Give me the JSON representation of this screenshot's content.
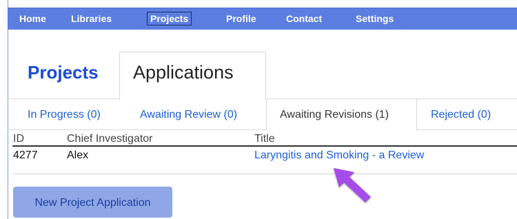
{
  "nav": {
    "items": [
      "Home",
      "Libraries",
      "Projects",
      "Profile",
      "Contact",
      "Settings"
    ],
    "active": "Projects"
  },
  "top_tabs": {
    "projects": "Projects",
    "applications": "Applications"
  },
  "sub_tabs": [
    {
      "label": "In Progress (0)"
    },
    {
      "label": "Awaiting Review (0)"
    },
    {
      "label": "Awaiting Revisions (1)"
    },
    {
      "label": "Rejected (0)"
    }
  ],
  "table": {
    "headers": [
      "ID",
      "Chief Investigator",
      "Title"
    ],
    "rows": [
      [
        "4277",
        "Alex",
        "Laryngitis and Smoking - a Review"
      ]
    ]
  },
  "new_button": "New Project Application",
  "colors": {
    "nav_bg": "#5b7ee0",
    "link": "#1a5fd6",
    "button_bg": "#8fa7e6",
    "arrow": "#a64ee8"
  },
  "annotation_icon": "arrow-pointer-icon"
}
